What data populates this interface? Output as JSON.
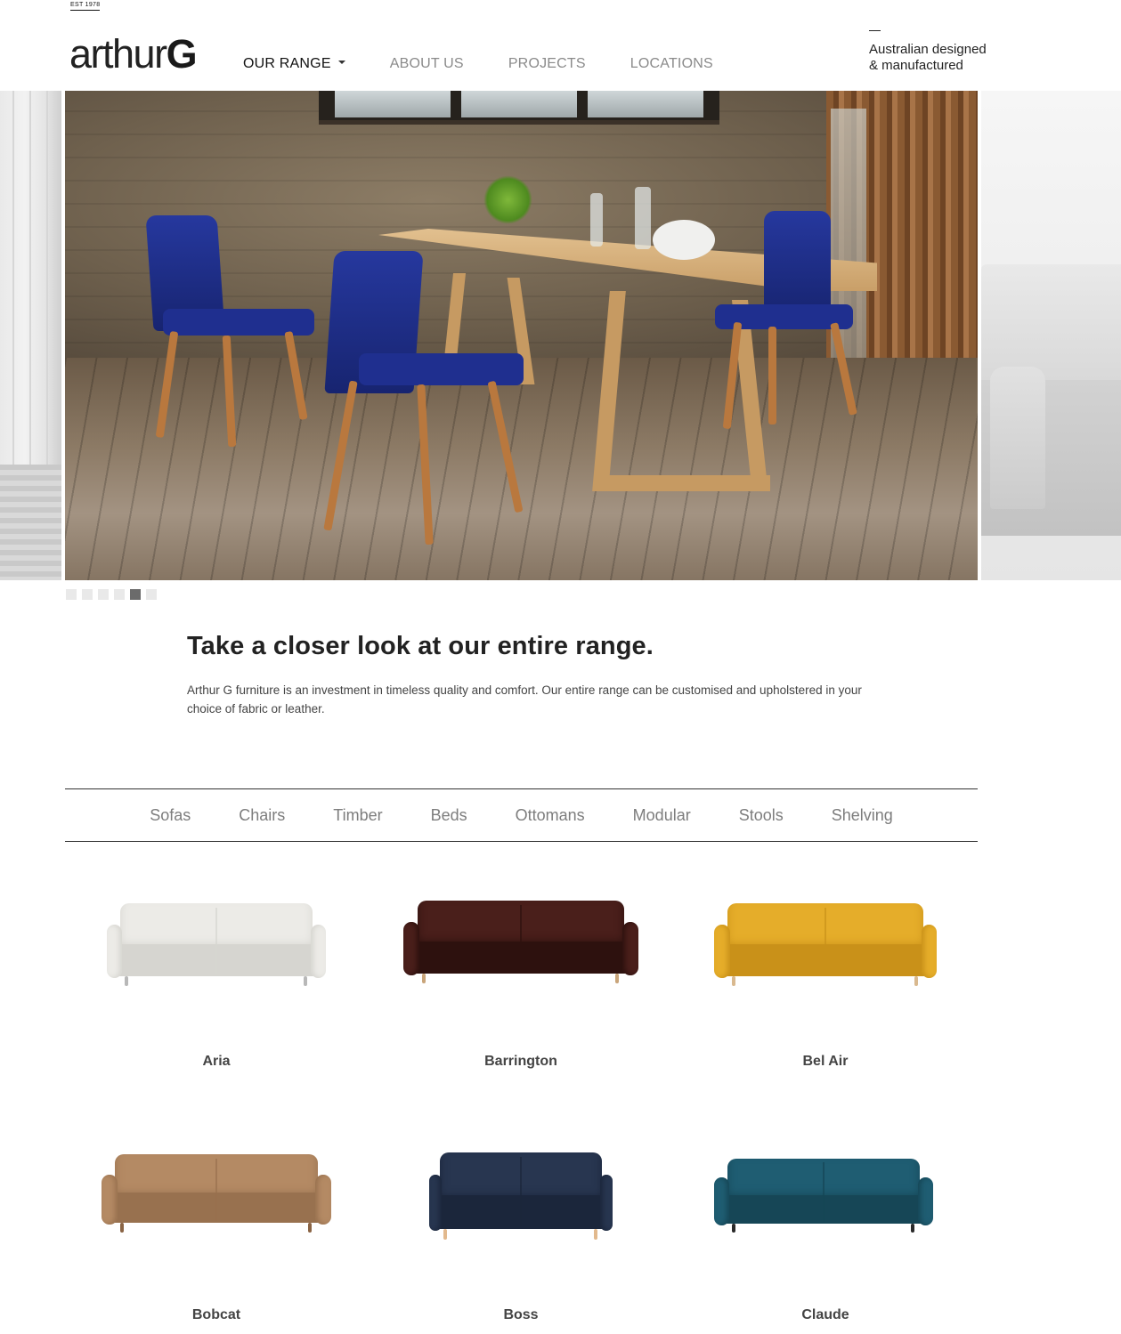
{
  "brand": {
    "est": "EST 1978",
    "logo_light": "arthur",
    "logo_bold": "G",
    "tagline_line1": "Australian designed",
    "tagline_line2": "& manufactured"
  },
  "nav": {
    "items": [
      {
        "label": "OUR RANGE",
        "active": true,
        "has_dropdown": true
      },
      {
        "label": "ABOUT US",
        "active": false
      },
      {
        "label": "PROJECTS",
        "active": false
      },
      {
        "label": "LOCATIONS",
        "active": false
      }
    ]
  },
  "slider": {
    "dot_count": 6,
    "active_index": 4
  },
  "intro": {
    "title": "Take a closer look at our entire range.",
    "text": "Arthur G furniture is an investment in timeless quality and comfort. Our entire range can be customised and upholstered in your choice of fabric or leather."
  },
  "categories": [
    "Sofas",
    "Chairs",
    "Timber",
    "Beds",
    "Ottomans",
    "Modular",
    "Stools",
    "Shelving"
  ],
  "products": [
    {
      "name": "Aria",
      "color": "#ecebe7",
      "accent": "#d6d5d0",
      "leg": "#b8b8b8"
    },
    {
      "name": "Barrington",
      "color": "#4a1f1b",
      "accent": "#2d110e",
      "leg": "#c9a57a"
    },
    {
      "name": "Bel Air",
      "color": "#e5ad2a",
      "accent": "#c99119",
      "leg": "#d9b98f"
    },
    {
      "name": "Bobcat",
      "color": "#b48a64",
      "accent": "#98714f",
      "leg": "#8a6444"
    },
    {
      "name": "Boss",
      "color": "#283650",
      "accent": "#1b263b",
      "leg": "#e2b98d"
    },
    {
      "name": "Claude",
      "color": "#1f5d72",
      "accent": "#164656",
      "leg": "#2a2a2a"
    }
  ],
  "colors": {
    "nav_active": "#111111",
    "nav_inactive": "#8a8a8a",
    "dot_active": "#6b6b6b",
    "dot_inactive": "#e9e9e9"
  }
}
